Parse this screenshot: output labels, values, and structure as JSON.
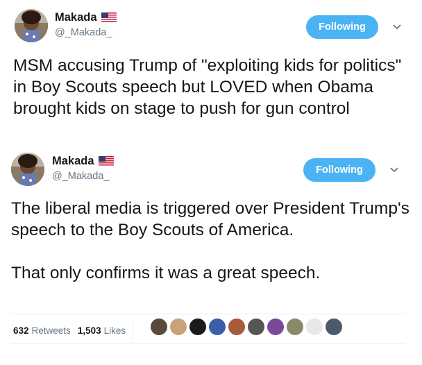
{
  "tweets": [
    {
      "display_name": "Makada",
      "handle": "@_Makada_",
      "follow_label": "Following",
      "text": "MSM accusing Trump of \"exploiting kids for politics\" in Boy Scouts speech but LOVED when Obama brought kids on stage to push for gun control"
    },
    {
      "display_name": "Makada",
      "handle": "@_Makada_",
      "follow_label": "Following",
      "text": "The liberal media is triggered over President Trump's speech to the Boy Scouts of America.\n\nThat only confirms it was a great speech.",
      "retweets_count": "632",
      "retweets_label": "Retweets",
      "likes_count": "1,503",
      "likes_label": "Likes"
    }
  ],
  "icons": {
    "flag": "us-flag-icon",
    "chevron": "chevron-down-icon"
  },
  "likers": [
    {
      "color": "#5a4a3a"
    },
    {
      "color": "#c9a27a"
    },
    {
      "color": "#1b1b1b"
    },
    {
      "color": "#3a5ea8"
    },
    {
      "color": "#a85a3a"
    },
    {
      "color": "#555555"
    },
    {
      "color": "#7a4a9a"
    },
    {
      "color": "#8a8a6a"
    },
    {
      "color": "#e8e8e8"
    },
    {
      "color": "#4a5a6a"
    }
  ],
  "colors": {
    "accent": "#4ab3f4",
    "secondary_text": "#657786",
    "primary_text": "#14171a"
  }
}
